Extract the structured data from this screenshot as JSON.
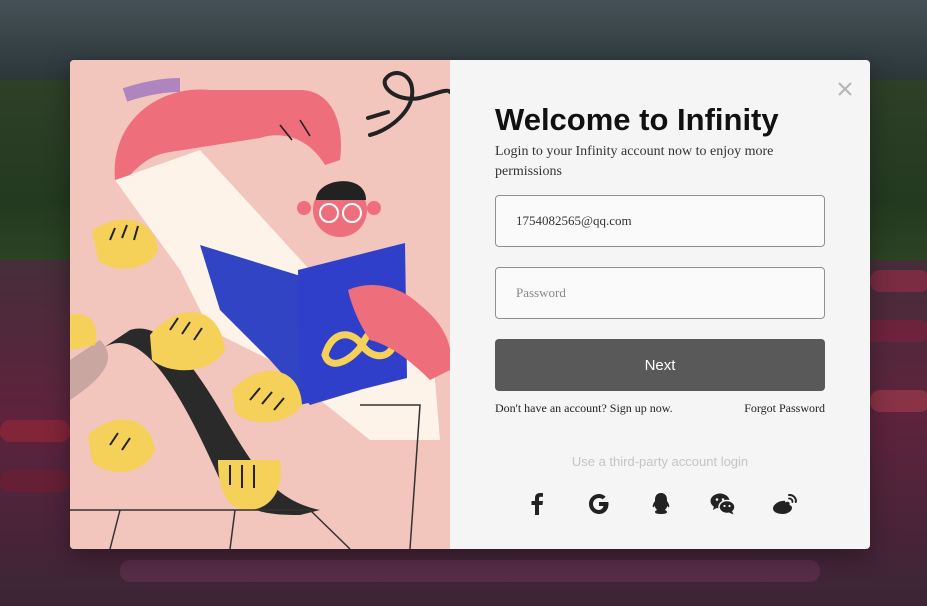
{
  "login": {
    "title": "Welcome to Infinity",
    "subtitle": "Login to your Infinity account now to enjoy more permissions",
    "email_value": "1754082565@qq.com",
    "password_placeholder": "Password",
    "next_label": "Next",
    "signup_text": "Don't have an account? Sign up now.",
    "forgot_text": "Forgot Password",
    "third_party_text": "Use a third-party account login"
  },
  "icons": {
    "close": "close-icon",
    "social": [
      "facebook-icon",
      "google-icon",
      "qq-icon",
      "wechat-icon",
      "weibo-icon"
    ]
  },
  "colors": {
    "illustration_bg": "#f2c5bd",
    "panel_bg": "#f5f5f5",
    "next_button": "#595959",
    "book": "#2f3fc9",
    "hand": "#ef6e7c",
    "accent_yellow": "#f6d15a"
  }
}
